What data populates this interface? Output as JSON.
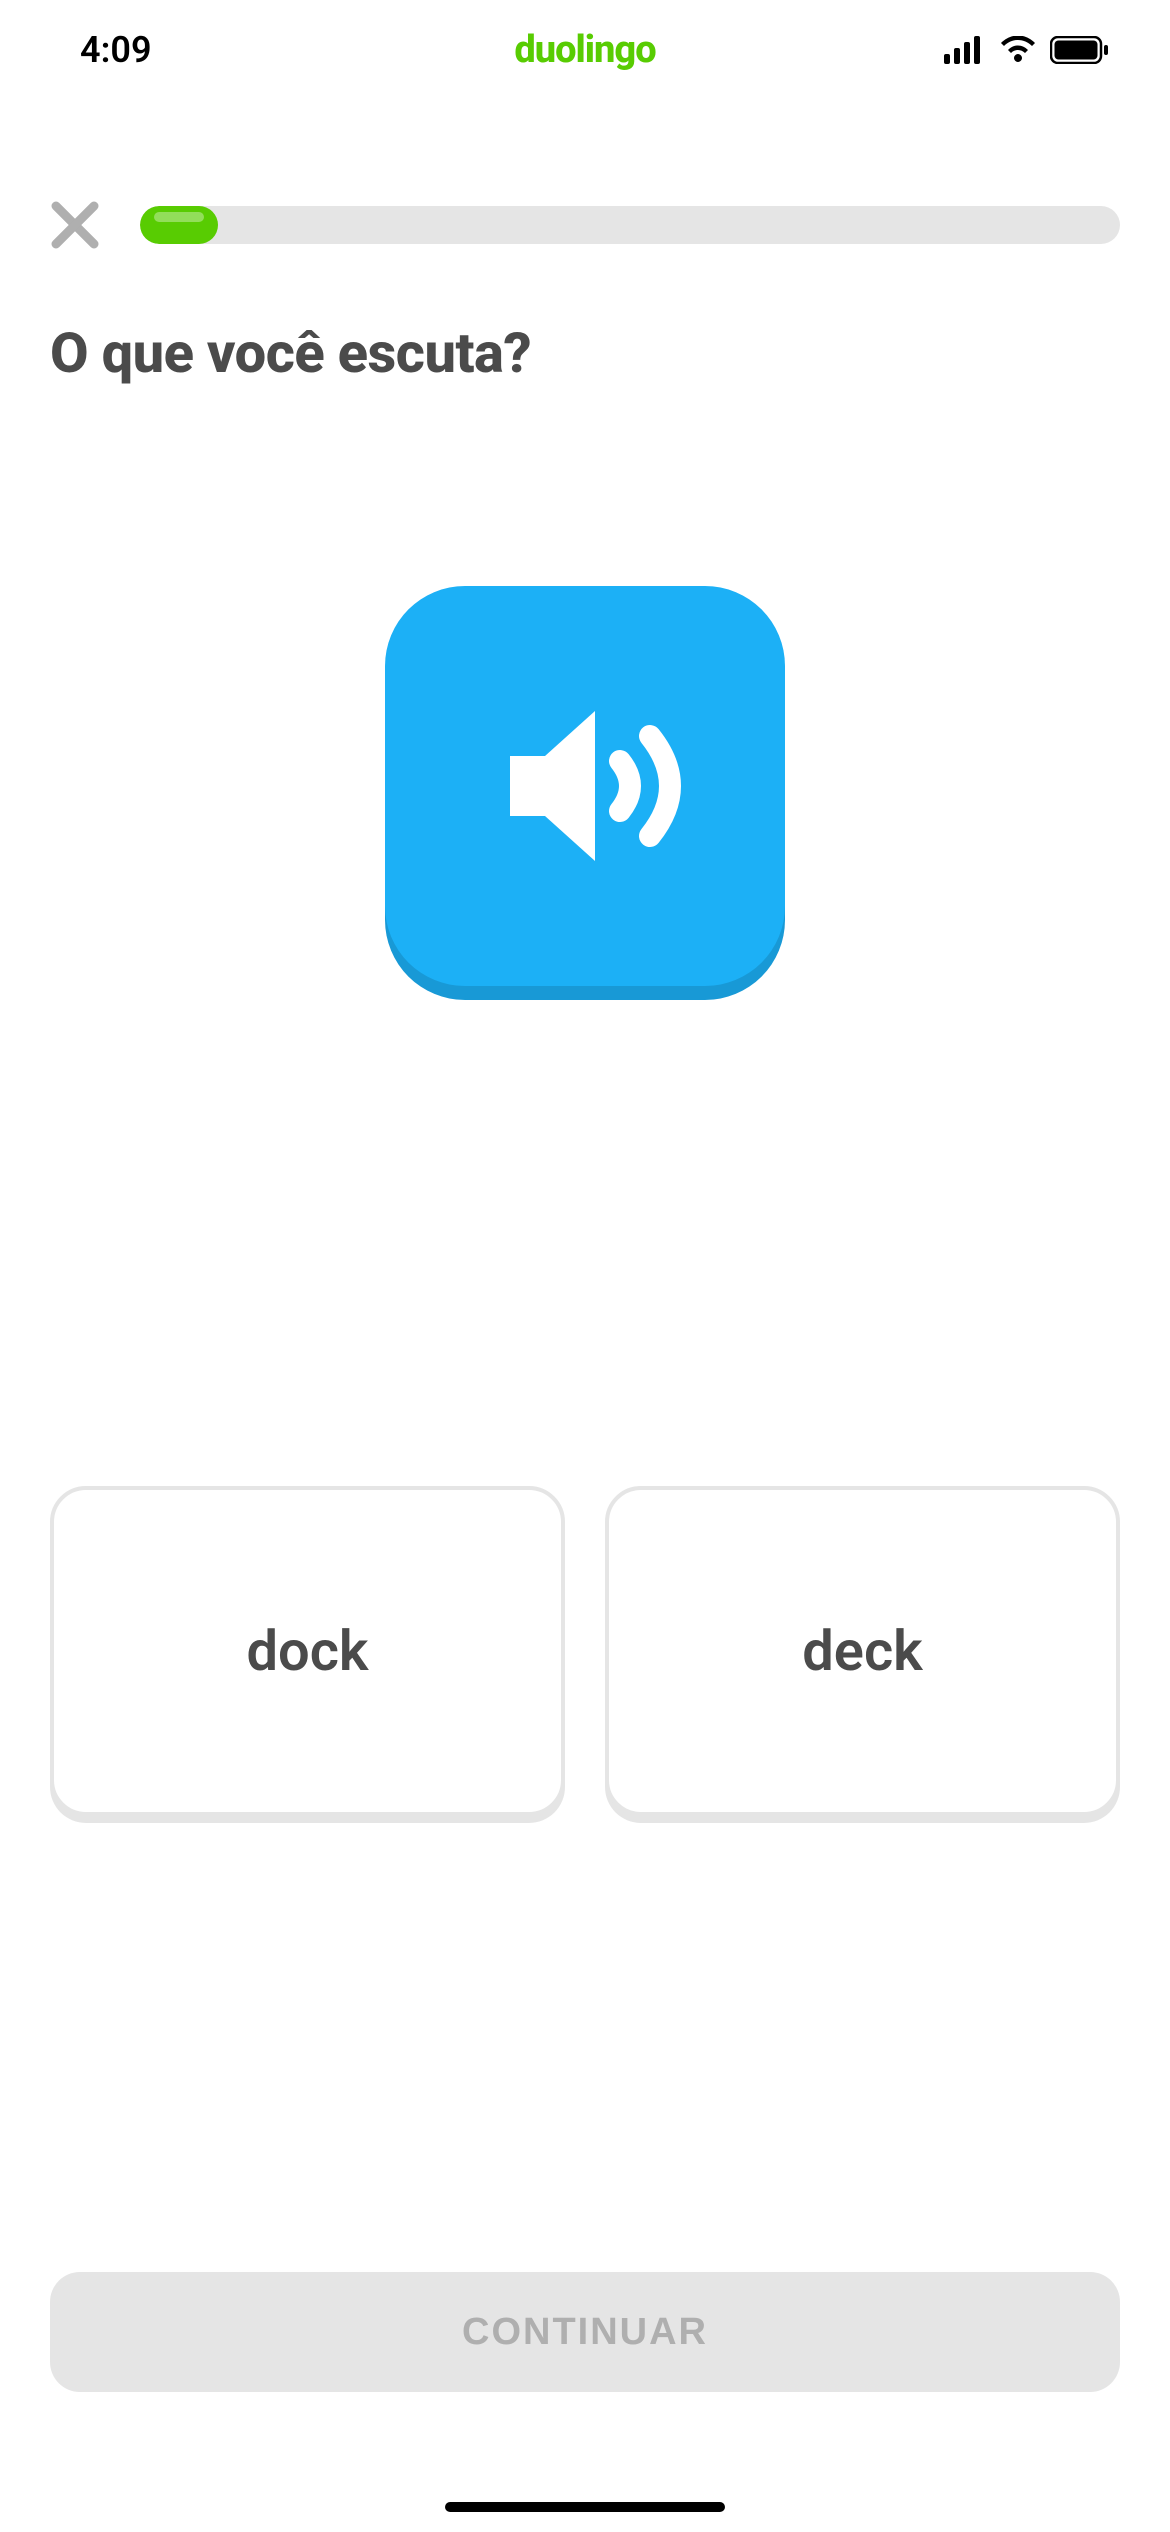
{
  "status": {
    "time": "4:09",
    "app_name": "duolingo"
  },
  "progress": {
    "percent": 8
  },
  "question": {
    "title": "O que você escuta?"
  },
  "options": [
    {
      "label": "dock"
    },
    {
      "label": "deck"
    }
  ],
  "footer": {
    "continue_label": "CONTINUAR"
  },
  "colors": {
    "brand_green": "#58cc02",
    "speaker_blue": "#1cb0f6",
    "speaker_blue_shadow": "#1899d6",
    "text_dark": "#4b4b4b",
    "border_gray": "#e5e5e5",
    "disabled_text": "#afafaf"
  }
}
